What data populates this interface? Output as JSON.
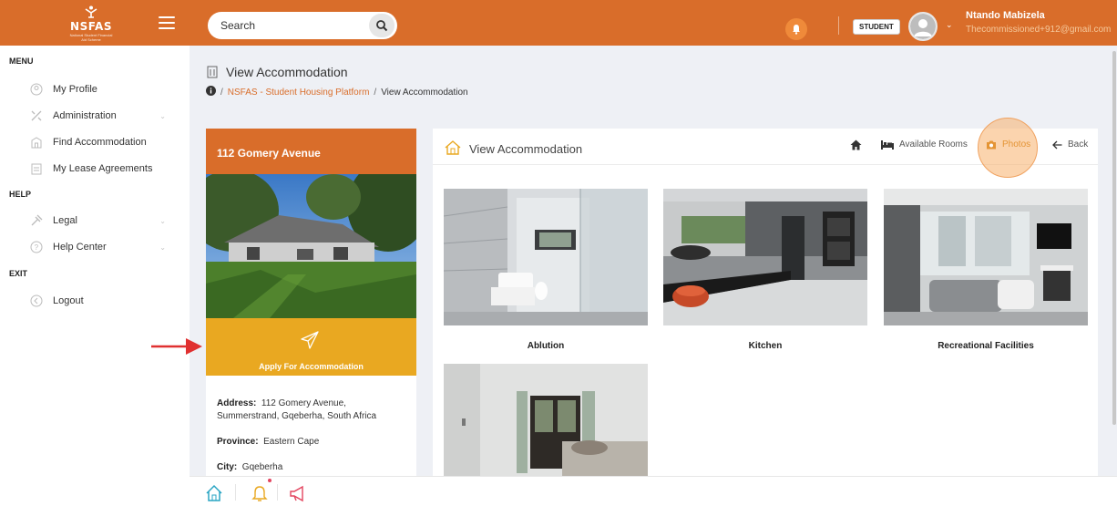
{
  "brand": {
    "name": "NSFAS",
    "tagline": "National Student Financial Aid Scheme",
    "color": "#d96d2a"
  },
  "search": {
    "placeholder": "Search"
  },
  "user": {
    "role": "STUDENT",
    "name": "Ntando Mabizela",
    "email": "Thecommissioned+912@gmail.com"
  },
  "sidebar": {
    "menu_title": "MENU",
    "help_title": "HELP",
    "exit_title": "EXIT",
    "items": [
      {
        "label": "My Profile",
        "icon": "user-icon"
      },
      {
        "label": "Administration",
        "icon": "tools-icon"
      },
      {
        "label": "Find Accommodation",
        "icon": "building-icon"
      },
      {
        "label": "My Lease Agreements",
        "icon": "document-icon"
      },
      {
        "label": "Legal",
        "icon": "gavel-icon"
      },
      {
        "label": "Help Center",
        "icon": "help-icon"
      },
      {
        "label": "Logout",
        "icon": "logout-icon"
      }
    ]
  },
  "header": {
    "title": "View Accommodation",
    "breadcrumb_link": "NSFAS - Student Housing Platform",
    "breadcrumb_current": "View Accommodation"
  },
  "property": {
    "name": "112 Gomery Avenue",
    "apply_label": "Apply For Accommodation",
    "address_label": "Address:",
    "address_value": "112 Gomery Avenue, Summerstrand, Gqeberha, South Africa",
    "province_label": "Province:",
    "province_value": "Eastern Cape",
    "city_label": "City:",
    "city_value": "Gqeberha"
  },
  "panel": {
    "title": "View Accommodation",
    "rooms_label": "Available Rooms",
    "photos_label": "Photos",
    "back_label": "Back",
    "accent_color": "#e49434"
  },
  "photos": [
    {
      "caption": "Ablution"
    },
    {
      "caption": "Kitchen"
    },
    {
      "caption": "Recreational Facilities"
    },
    {
      "caption": ""
    }
  ]
}
